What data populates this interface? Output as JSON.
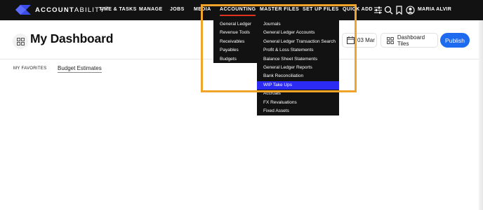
{
  "brand": {
    "name_bold": "ACCOUNT",
    "name_light": "ABILITY",
    "mark": "™"
  },
  "nav": [
    {
      "label": "TIME & TASKS"
    },
    {
      "label": "MANAGE"
    },
    {
      "label": "JOBS"
    },
    {
      "label": "MEDIA"
    },
    {
      "label": "ACCOUNTING"
    },
    {
      "label": "MASTER FILES"
    },
    {
      "label": "SET UP FILES"
    },
    {
      "label": "QUICK ADD"
    }
  ],
  "user": {
    "name": "MARIA ALVIR"
  },
  "page": {
    "title": "My Dashboard"
  },
  "favorites": {
    "label": "MY FAVORITES",
    "link": "Budget Estimates"
  },
  "toolbar": {
    "date_label": "03 Mar",
    "tiles_label": "Dashboard Tiles",
    "publish_label": "Publish"
  },
  "accounting_menu": {
    "left": [
      "General Ledger",
      "Revenue Tools",
      "Receivables",
      "Payables",
      "Budgets"
    ],
    "right": [
      "Journals",
      "General Ledger Accounts",
      "General Ledger Transaction Search",
      "Profit & Loss Statements",
      "Balance Sheet Statements",
      "General Ledger Reports",
      "Bank Reconciliation",
      "WIP Take Ups",
      "Accruals",
      "FX Revaluations",
      "Fixed Assets"
    ],
    "highlighted": "WIP Take Ups"
  },
  "colors": {
    "topbar": "#121212",
    "accent": "#1f6bf0",
    "highlight": "#2b2bf3",
    "annotation": "#f0a52a",
    "active_underline": "#e0321e"
  }
}
